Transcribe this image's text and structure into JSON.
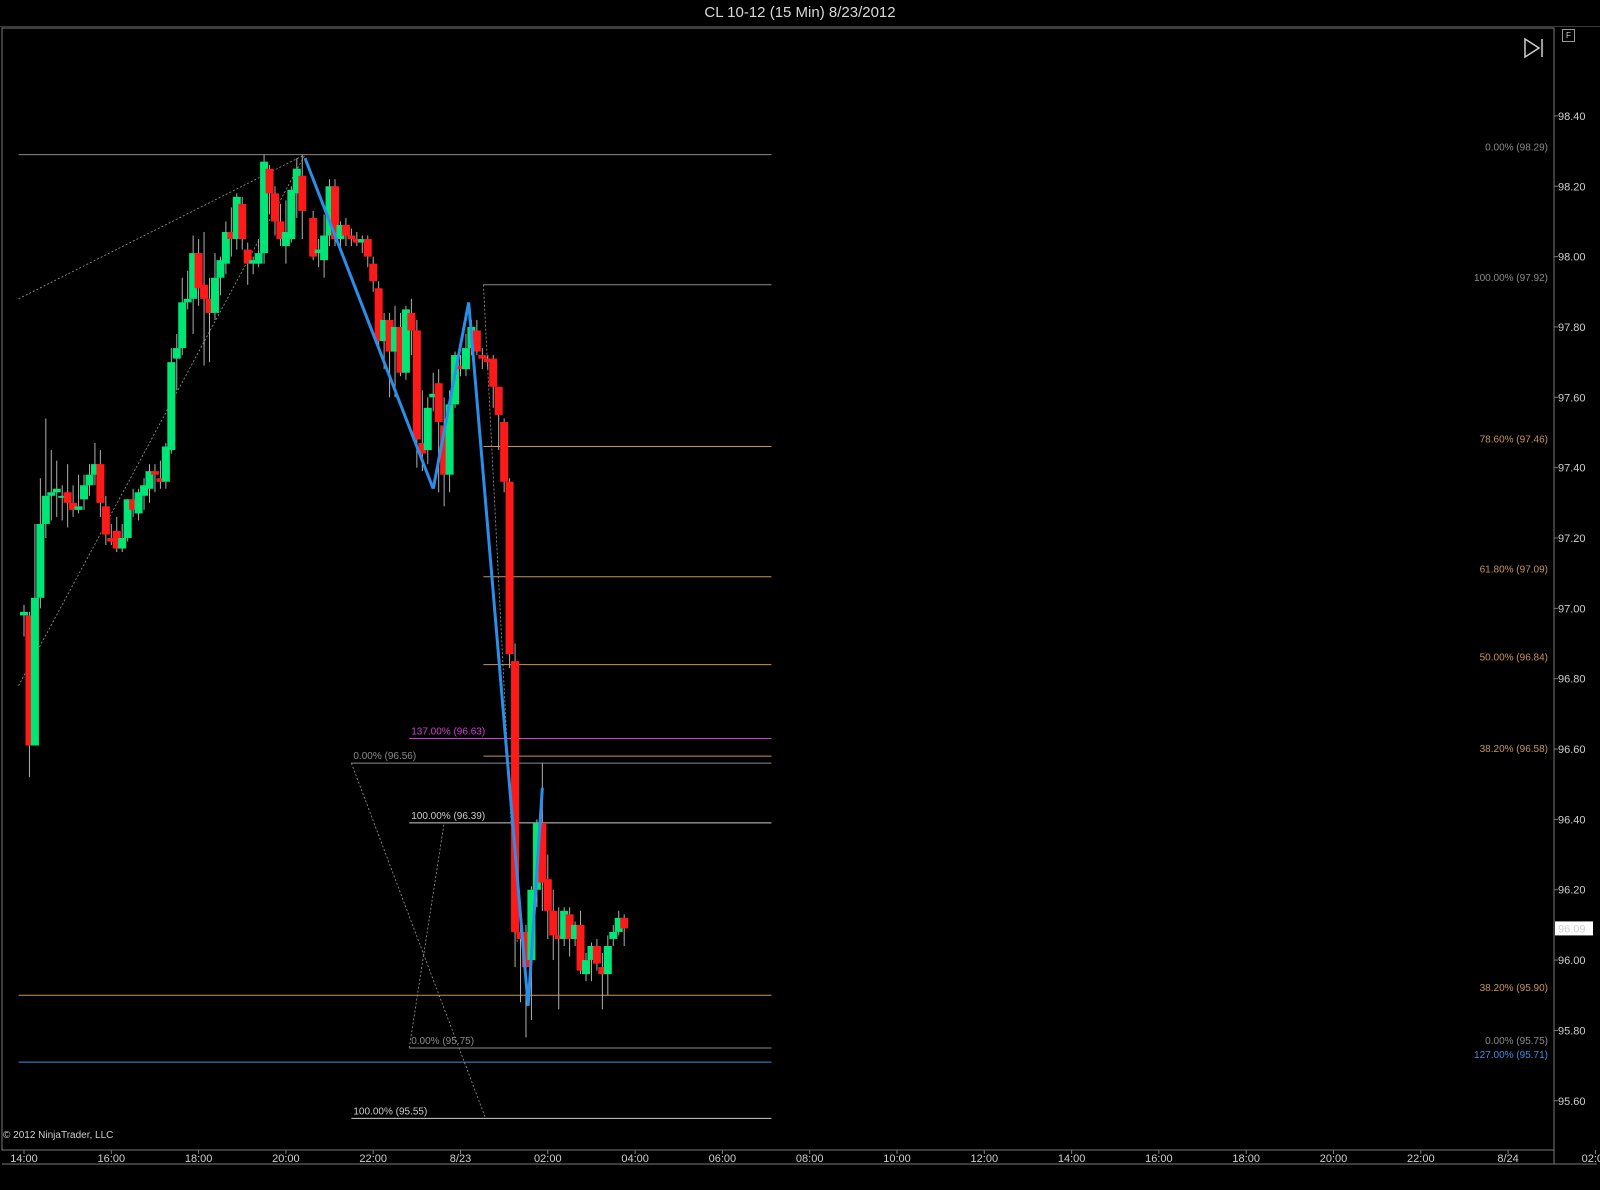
{
  "window": {
    "title": "CL 10-12 (15 Min)  8/23/2012"
  },
  "copyright": "© 2012 NinjaTrader, LLC",
  "icons": {
    "chart_menu": "F",
    "play": "play-end-icon"
  },
  "colors": {
    "up": "#00e676",
    "down": "#ff1a1a",
    "swing": "#2a8fe8",
    "fib_gray": "#8a8a8a",
    "fib_orange": "#c8945a",
    "magenta": "#d040d0",
    "blue_line": "#3a8fe0",
    "last_price_bg": "#ffffff"
  },
  "chart_data": {
    "type": "candlestick",
    "title": "CL 10-12 (15 Min)  8/23/2012",
    "ylim": [
      95.46,
      98.65
    ],
    "y_ticks": [
      "98.40",
      "98.20",
      "98.00",
      "97.80",
      "97.60",
      "97.40",
      "97.20",
      "97.00",
      "96.80",
      "96.60",
      "96.40",
      "96.20",
      "96.00",
      "95.80",
      "95.60"
    ],
    "x_ticks": [
      "14:00",
      "16:00",
      "18:00",
      "20:00",
      "22:00",
      "8/23",
      "02:00",
      "04:00",
      "06:00",
      "08:00",
      "10:00",
      "12:00",
      "14:00",
      "16:00",
      "18:00",
      "20:00",
      "22:00",
      "8/24",
      "02:00"
    ],
    "last_price": "96.09",
    "candles": [
      {
        "t": 0,
        "o": 96.98,
        "h": 97.01,
        "l": 96.92,
        "c": 96.99
      },
      {
        "t": 0.5,
        "o": 96.98,
        "h": 96.99,
        "l": 96.52,
        "c": 96.61
      },
      {
        "t": 1,
        "o": 96.61,
        "h": 97.24,
        "l": 96.61,
        "c": 97.03
      },
      {
        "t": 1.5,
        "o": 97.03,
        "h": 97.37,
        "l": 97.0,
        "c": 97.24
      },
      {
        "t": 2,
        "o": 97.24,
        "h": 97.54,
        "l": 97.2,
        "c": 97.32
      },
      {
        "t": 2.5,
        "o": 97.32,
        "h": 97.45,
        "l": 97.25,
        "c": 97.33
      },
      {
        "t": 3,
        "o": 97.33,
        "h": 97.42,
        "l": 97.26,
        "c": 97.34
      },
      {
        "t": 3.5,
        "o": 97.32,
        "h": 97.35,
        "l": 97.25,
        "c": 97.32
      },
      {
        "t": 4,
        "o": 97.33,
        "h": 97.41,
        "l": 97.23,
        "c": 97.3
      },
      {
        "t": 4.5,
        "o": 97.3,
        "h": 97.35,
        "l": 97.26,
        "c": 97.28
      },
      {
        "t": 5,
        "o": 97.28,
        "h": 97.38,
        "l": 97.27,
        "c": 97.29
      },
      {
        "t": 5.5,
        "o": 97.31,
        "h": 97.38,
        "l": 97.28,
        "c": 97.35
      },
      {
        "t": 6,
        "o": 97.35,
        "h": 97.41,
        "l": 97.32,
        "c": 97.38
      },
      {
        "t": 6.5,
        "o": 97.38,
        "h": 97.47,
        "l": 97.35,
        "c": 97.41
      },
      {
        "t": 7,
        "o": 97.41,
        "h": 97.45,
        "l": 97.26,
        "c": 97.3
      },
      {
        "t": 7.5,
        "o": 97.29,
        "h": 97.32,
        "l": 97.18,
        "c": 97.21
      },
      {
        "t": 8,
        "o": 97.2,
        "h": 97.24,
        "l": 97.18,
        "c": 97.19
      },
      {
        "t": 8.5,
        "o": 97.22,
        "h": 97.26,
        "l": 97.16,
        "c": 97.17
      },
      {
        "t": 9,
        "o": 97.17,
        "h": 97.24,
        "l": 97.16,
        "c": 97.2
      },
      {
        "t": 9.5,
        "o": 97.2,
        "h": 97.31,
        "l": 97.19,
        "c": 97.31
      },
      {
        "t": 10,
        "o": 97.31,
        "h": 97.34,
        "l": 97.26,
        "c": 97.28
      },
      {
        "t": 10.5,
        "o": 97.27,
        "h": 97.34,
        "l": 97.25,
        "c": 97.33
      },
      {
        "t": 11,
        "o": 97.32,
        "h": 97.37,
        "l": 97.28,
        "c": 97.35
      },
      {
        "t": 11.5,
        "o": 97.34,
        "h": 97.41,
        "l": 97.3,
        "c": 97.39
      },
      {
        "t": 12,
        "o": 97.39,
        "h": 97.41,
        "l": 97.33,
        "c": 97.38
      },
      {
        "t": 12.5,
        "o": 97.37,
        "h": 97.42,
        "l": 97.34,
        "c": 97.36
      },
      {
        "t": 13,
        "o": 97.36,
        "h": 97.47,
        "l": 97.34,
        "c": 97.46
      },
      {
        "t": 13.5,
        "o": 97.45,
        "h": 97.74,
        "l": 97.44,
        "c": 97.7
      },
      {
        "t": 14,
        "o": 97.71,
        "h": 97.78,
        "l": 97.62,
        "c": 97.74
      },
      {
        "t": 14.5,
        "o": 97.74,
        "h": 97.94,
        "l": 97.72,
        "c": 97.87
      },
      {
        "t": 15,
        "o": 97.87,
        "h": 97.96,
        "l": 97.85,
        "c": 97.88
      },
      {
        "t": 15.5,
        "o": 97.88,
        "h": 98.06,
        "l": 97.78,
        "c": 98.01
      },
      {
        "t": 16,
        "o": 98.01,
        "h": 98.05,
        "l": 97.86,
        "c": 97.91
      },
      {
        "t": 16.5,
        "o": 97.92,
        "h": 98.07,
        "l": 97.69,
        "c": 97.88
      },
      {
        "t": 17,
        "o": 97.88,
        "h": 97.94,
        "l": 97.7,
        "c": 97.84
      },
      {
        "t": 17.5,
        "o": 97.84,
        "h": 98.01,
        "l": 97.82,
        "c": 97.94
      },
      {
        "t": 18,
        "o": 97.94,
        "h": 98.0,
        "l": 97.89,
        "c": 97.99
      },
      {
        "t": 18.5,
        "o": 97.98,
        "h": 98.1,
        "l": 97.95,
        "c": 98.07
      },
      {
        "t": 19,
        "o": 98.07,
        "h": 98.14,
        "l": 98.0,
        "c": 98.05
      },
      {
        "t": 19.5,
        "o": 98.05,
        "h": 98.18,
        "l": 98.02,
        "c": 98.17
      },
      {
        "t": 20,
        "o": 98.15,
        "h": 98.17,
        "l": 98.02,
        "c": 98.05
      },
      {
        "t": 20.5,
        "o": 98.02,
        "h": 98.04,
        "l": 97.92,
        "c": 97.98
      },
      {
        "t": 21,
        "o": 97.98,
        "h": 98.0,
        "l": 97.95,
        "c": 97.99
      },
      {
        "t": 21.5,
        "o": 97.98,
        "h": 98.05,
        "l": 97.97,
        "c": 98.01
      },
      {
        "t": 22,
        "o": 98.01,
        "h": 98.29,
        "l": 97.98,
        "c": 98.27
      },
      {
        "t": 22.5,
        "o": 98.25,
        "h": 98.26,
        "l": 98.12,
        "c": 98.18
      },
      {
        "t": 23,
        "o": 98.18,
        "h": 98.2,
        "l": 98.06,
        "c": 98.1
      },
      {
        "t": 23.5,
        "o": 98.1,
        "h": 98.15,
        "l": 98.03,
        "c": 98.05
      },
      {
        "t": 24,
        "o": 98.03,
        "h": 98.16,
        "l": 97.98,
        "c": 98.07
      },
      {
        "t": 24.5,
        "o": 98.05,
        "h": 98.2,
        "l": 98.04,
        "c": 98.19
      },
      {
        "t": 25,
        "o": 98.18,
        "h": 98.28,
        "l": 98.11,
        "c": 98.25
      },
      {
        "t": 25.5,
        "o": 98.23,
        "h": 98.29,
        "l": 98.05,
        "c": 98.13
      },
      {
        "t": 26.5,
        "o": 98.11,
        "h": 98.13,
        "l": 97.99,
        "c": 98.0
      },
      {
        "t": 27,
        "o": 98.01,
        "h": 98.05,
        "l": 97.97,
        "c": 98.02
      },
      {
        "t": 27.5,
        "o": 97.99,
        "h": 98.12,
        "l": 97.94,
        "c": 98.06
      },
      {
        "t": 28,
        "o": 98.06,
        "h": 98.22,
        "l": 98.03,
        "c": 98.2
      },
      {
        "t": 28.5,
        "o": 98.2,
        "h": 98.22,
        "l": 98.03,
        "c": 98.05
      },
      {
        "t": 29,
        "o": 98.05,
        "h": 98.1,
        "l": 98.02,
        "c": 98.09
      },
      {
        "t": 29.5,
        "o": 98.09,
        "h": 98.11,
        "l": 98.03,
        "c": 98.06
      },
      {
        "t": 30,
        "o": 98.06,
        "h": 98.08,
        "l": 98.03,
        "c": 98.05
      },
      {
        "t": 30.5,
        "o": 98.05,
        "h": 98.07,
        "l": 98.03,
        "c": 98.04
      },
      {
        "t": 31,
        "o": 98.04,
        "h": 98.06,
        "l": 98.01,
        "c": 98.05
      },
      {
        "t": 31.5,
        "o": 98.05,
        "h": 98.06,
        "l": 97.97,
        "c": 98.0
      },
      {
        "t": 32,
        "o": 97.98,
        "h": 98.0,
        "l": 97.9,
        "c": 97.93
      },
      {
        "t": 32.5,
        "o": 97.91,
        "h": 97.93,
        "l": 97.74,
        "c": 97.76
      },
      {
        "t": 33,
        "o": 97.76,
        "h": 97.84,
        "l": 97.68,
        "c": 97.82
      },
      {
        "t": 33.5,
        "o": 97.82,
        "h": 97.84,
        "l": 97.6,
        "c": 97.73
      },
      {
        "t": 34,
        "o": 97.73,
        "h": 97.86,
        "l": 97.6,
        "c": 97.8
      },
      {
        "t": 34.5,
        "o": 97.8,
        "h": 97.84,
        "l": 97.66,
        "c": 97.67
      },
      {
        "t": 35,
        "o": 97.67,
        "h": 97.86,
        "l": 97.65,
        "c": 97.85
      },
      {
        "t": 35.5,
        "o": 97.84,
        "h": 97.88,
        "l": 97.72,
        "c": 97.79
      },
      {
        "t": 36,
        "o": 97.79,
        "h": 97.82,
        "l": 97.4,
        "c": 97.48
      },
      {
        "t": 36.5,
        "o": 97.47,
        "h": 97.62,
        "l": 97.39,
        "c": 97.44
      },
      {
        "t": 37,
        "o": 97.45,
        "h": 97.6,
        "l": 97.41,
        "c": 97.57
      },
      {
        "t": 37.5,
        "o": 97.6,
        "h": 97.67,
        "l": 97.56,
        "c": 97.61
      },
      {
        "t": 38,
        "o": 97.64,
        "h": 97.68,
        "l": 97.33,
        "c": 97.53
      },
      {
        "t": 38.5,
        "o": 97.52,
        "h": 97.6,
        "l": 97.29,
        "c": 97.38
      },
      {
        "t": 39,
        "o": 97.38,
        "h": 97.62,
        "l": 97.33,
        "c": 97.58
      },
      {
        "t": 39.5,
        "o": 97.58,
        "h": 97.73,
        "l": 97.57,
        "c": 97.72
      },
      {
        "t": 40,
        "o": 97.69,
        "h": 97.72,
        "l": 97.66,
        "c": 97.68
      },
      {
        "t": 40.5,
        "o": 97.68,
        "h": 97.78,
        "l": 97.66,
        "c": 97.74
      },
      {
        "t": 41,
        "o": 97.74,
        "h": 97.82,
        "l": 97.72,
        "c": 97.8
      },
      {
        "t": 41.5,
        "o": 97.79,
        "h": 97.82,
        "l": 97.72,
        "c": 97.73
      },
      {
        "t": 42,
        "o": 97.72,
        "h": 97.74,
        "l": 97.68,
        "c": 97.71
      },
      {
        "t": 42.5,
        "o": 97.71,
        "h": 97.72,
        "l": 97.68,
        "c": 97.7
      },
      {
        "t": 43,
        "o": 97.71,
        "h": 97.72,
        "l": 97.57,
        "c": 97.63
      },
      {
        "t": 43.5,
        "o": 97.63,
        "h": 97.63,
        "l": 97.45,
        "c": 97.55
      },
      {
        "t": 44,
        "o": 97.53,
        "h": 97.54,
        "l": 97.33,
        "c": 97.36
      },
      {
        "t": 44.5,
        "o": 97.36,
        "h": 97.37,
        "l": 96.83,
        "c": 96.87
      },
      {
        "t": 45,
        "o": 96.85,
        "h": 96.9,
        "l": 95.98,
        "c": 96.08
      },
      {
        "t": 45.5,
        "o": 96.08,
        "h": 96.1,
        "l": 95.88,
        "c": 96.06
      },
      {
        "t": 46,
        "o": 96.08,
        "h": 96.1,
        "l": 95.78,
        "c": 95.98
      },
      {
        "t": 46.5,
        "o": 96.0,
        "h": 96.21,
        "l": 95.83,
        "c": 96.2
      },
      {
        "t": 47,
        "o": 96.2,
        "h": 96.4,
        "l": 96.15,
        "c": 96.39
      },
      {
        "t": 47.5,
        "o": 96.39,
        "h": 96.56,
        "l": 96.14,
        "c": 96.22
      },
      {
        "t": 48,
        "o": 96.23,
        "h": 96.3,
        "l": 96.06,
        "c": 96.14
      },
      {
        "t": 48.5,
        "o": 96.14,
        "h": 96.2,
        "l": 96.0,
        "c": 96.07
      },
      {
        "t": 49,
        "o": 96.07,
        "h": 96.15,
        "l": 95.86,
        "c": 96.06
      },
      {
        "t": 49.5,
        "o": 96.06,
        "h": 96.15,
        "l": 96.04,
        "c": 96.14
      },
      {
        "t": 50,
        "o": 96.13,
        "h": 96.15,
        "l": 96.01,
        "c": 96.06
      },
      {
        "t": 50.5,
        "o": 96.06,
        "h": 96.11,
        "l": 96.04,
        "c": 96.1
      },
      {
        "t": 51,
        "o": 96.1,
        "h": 96.14,
        "l": 95.96,
        "c": 95.97
      },
      {
        "t": 51.5,
        "o": 95.96,
        "h": 96.02,
        "l": 95.94,
        "c": 96.0
      },
      {
        "t": 52,
        "o": 96.0,
        "h": 96.05,
        "l": 95.94,
        "c": 96.04
      },
      {
        "t": 52.5,
        "o": 96.04,
        "h": 96.06,
        "l": 95.97,
        "c": 95.99
      },
      {
        "t": 53,
        "o": 95.98,
        "h": 96.02,
        "l": 95.86,
        "c": 95.96
      },
      {
        "t": 53.5,
        "o": 95.96,
        "h": 96.07,
        "l": 95.9,
        "c": 96.04
      },
      {
        "t": 54,
        "o": 96.06,
        "h": 96.1,
        "l": 96.04,
        "c": 96.08
      },
      {
        "t": 54.5,
        "o": 96.08,
        "h": 96.14,
        "l": 96.07,
        "c": 96.12
      },
      {
        "t": 55,
        "o": 96.12,
        "h": 96.13,
        "l": 96.04,
        "c": 96.09
      }
    ],
    "swing_lines": [
      {
        "points": [
          [
            25.75,
            98.28
          ],
          [
            37.5,
            97.34
          ]
        ]
      },
      {
        "points": [
          [
            37.5,
            97.34
          ],
          [
            40.75,
            97.87
          ]
        ]
      },
      {
        "points": [
          [
            40.75,
            97.87
          ],
          [
            46.2,
            95.87
          ]
        ]
      },
      {
        "points": [
          [
            46.2,
            95.87
          ],
          [
            47.5,
            96.49
          ]
        ]
      }
    ],
    "trend_lines": [
      {
        "points": [
          [
            -0.5,
            97.88
          ],
          [
            25.75,
            98.29
          ]
        ]
      },
      {
        "points": [
          [
            -0.5,
            96.78
          ],
          [
            25.75,
            98.29
          ]
        ]
      },
      {
        "points": [
          [
            42.1,
            97.92
          ],
          [
            45.2,
            96.05
          ]
        ]
      },
      {
        "points": [
          [
            35.3,
            95.75
          ],
          [
            38.5,
            96.39
          ]
        ]
      },
      {
        "points": [
          [
            30.0,
            96.56
          ],
          [
            42.3,
            95.55
          ]
        ]
      }
    ],
    "fib_levels": [
      {
        "label": "0.00% (98.29)",
        "price": 98.29,
        "x_from": -0.5,
        "x_to": 68.5,
        "anchor": "end",
        "color": "gray"
      },
      {
        "label": "100.00% (97.92)",
        "price": 97.92,
        "x_from": 42.1,
        "x_to": 68.5,
        "anchor": "end",
        "color": "gray"
      },
      {
        "label": "78.60% (97.46)",
        "price": 97.46,
        "x_from": 42.1,
        "x_to": 68.5,
        "anchor": "end",
        "color": "orange"
      },
      {
        "label": "61.80% (97.09)",
        "price": 97.09,
        "x_from": 42.1,
        "x_to": 68.5,
        "anchor": "end",
        "color": "orange"
      },
      {
        "label": "50.00% (96.84)",
        "price": 96.84,
        "x_from": 42.1,
        "x_to": 68.5,
        "anchor": "end",
        "color": "orange"
      },
      {
        "label": "137.00% (96.63)",
        "price": 96.63,
        "x_from": 35.3,
        "x_to": 68.5,
        "anchor": "start",
        "color": "magenta"
      },
      {
        "label": "38.20% (96.58)",
        "price": 96.58,
        "x_from": 42.1,
        "x_to": 68.5,
        "anchor": "end",
        "color": "orange"
      },
      {
        "label": "0.00% (96.56)",
        "price": 96.56,
        "x_from": 30.0,
        "x_to": 68.5,
        "anchor": "start",
        "color": "gray"
      },
      {
        "label": "100.00% (96.39)",
        "price": 96.39,
        "x_from": 35.3,
        "x_to": 68.5,
        "anchor": "start",
        "color": "white"
      },
      {
        "label": "38.20% (95.90)",
        "price": 95.9,
        "x_from": -0.5,
        "x_to": 68.5,
        "anchor": "end",
        "color": "orange"
      },
      {
        "label": "0.00% (95.75)",
        "price": 95.75,
        "x_from": 35.3,
        "x_to": 68.5,
        "anchor": "start",
        "color": "gray"
      },
      {
        "label": "0.00% (95.75)",
        "price": 95.75,
        "x_from": 35.3,
        "x_to": 68.5,
        "anchor": "end",
        "color": "gray"
      },
      {
        "label": "127.00% (95.71)",
        "price": 95.71,
        "x_from": -0.5,
        "x_to": 68.5,
        "anchor": "end",
        "color": "blue"
      },
      {
        "label": "100.00% (95.55)",
        "price": 95.55,
        "x_from": 30.0,
        "x_to": 68.5,
        "anchor": "start",
        "color": "white"
      }
    ]
  }
}
